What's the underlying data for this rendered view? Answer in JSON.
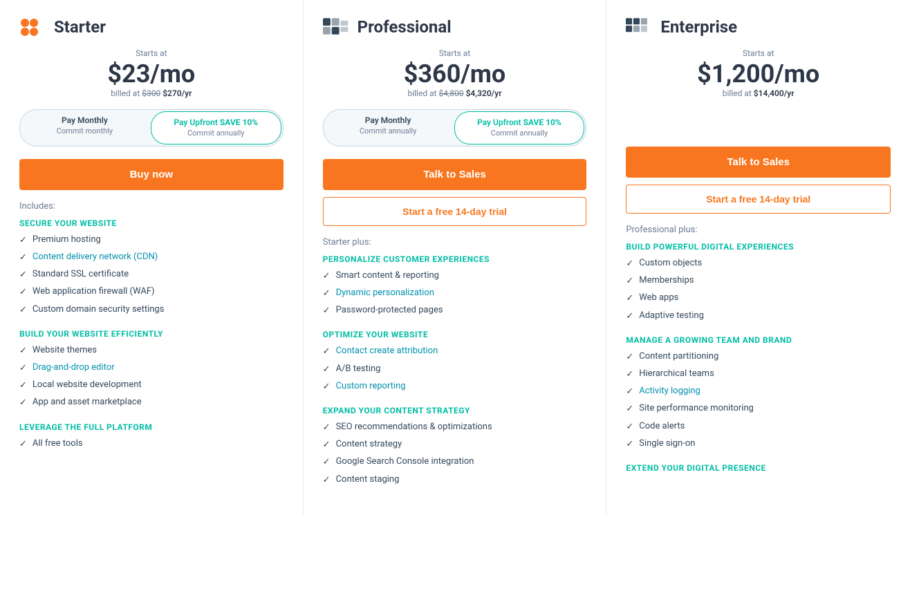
{
  "plans": [
    {
      "id": "starter",
      "title": "Starter",
      "icon_type": "starter",
      "starts_at": "Starts at",
      "price": "$23/mo",
      "billed_label": "billed at",
      "billed_original": "$300",
      "billed_discounted": "$270/yr",
      "toggle": {
        "option1": {
          "top": "Pay Monthly",
          "bottom": "Commit monthly",
          "active": false
        },
        "option2": {
          "top": "Pay Upfront",
          "save": "SAVE 10%",
          "bottom": "Commit annually",
          "active": true
        }
      },
      "cta_primary": "Buy now",
      "cta_secondary": null,
      "includes_label": "Includes:",
      "feature_groups": [
        {
          "title": "SECURE YOUR WEBSITE",
          "items": [
            {
              "text": "Premium hosting",
              "link": false
            },
            {
              "text": "Content delivery network (CDN)",
              "link": true
            },
            {
              "text": "Standard SSL certificate",
              "link": false
            },
            {
              "text": "Web application firewall (WAF)",
              "link": false
            },
            {
              "text": "Custom domain security settings",
              "link": false
            }
          ]
        },
        {
          "title": "BUILD YOUR WEBSITE EFFICIENTLY",
          "items": [
            {
              "text": "Website themes",
              "link": false
            },
            {
              "text": "Drag-and-drop editor",
              "link": true
            },
            {
              "text": "Local website development",
              "link": false
            },
            {
              "text": "App and asset marketplace",
              "link": false
            }
          ]
        },
        {
          "title": "LEVERAGE THE FULL PLATFORM",
          "items": [
            {
              "text": "All free tools",
              "link": false
            }
          ]
        }
      ]
    },
    {
      "id": "professional",
      "title": "Professional",
      "icon_type": "professional",
      "starts_at": "Starts at",
      "price": "$360/mo",
      "billed_label": "billed at",
      "billed_original": "$4,800",
      "billed_discounted": "$4,320/yr",
      "toggle": {
        "option1": {
          "top": "Pay Monthly",
          "bottom": "Commit annually",
          "active": false
        },
        "option2": {
          "top": "Pay Upfront",
          "save": "SAVE 10%",
          "bottom": "Commit annually",
          "active": true
        }
      },
      "cta_primary": "Talk to Sales",
      "cta_secondary": "Start a free 14-day trial",
      "includes_label": "Starter plus:",
      "feature_groups": [
        {
          "title": "PERSONALIZE CUSTOMER EXPERIENCES",
          "items": [
            {
              "text": "Smart content & reporting",
              "link": false
            },
            {
              "text": "Dynamic personalization",
              "link": true
            },
            {
              "text": "Password-protected pages",
              "link": false
            }
          ]
        },
        {
          "title": "OPTIMIZE YOUR WEBSITE",
          "items": [
            {
              "text": "Contact create attribution",
              "link": true
            },
            {
              "text": "A/B testing",
              "link": false
            },
            {
              "text": "Custom reporting",
              "link": true
            }
          ]
        },
        {
          "title": "EXPAND YOUR CONTENT STRATEGY",
          "items": [
            {
              "text": "SEO recommendations & optimizations",
              "link": false
            },
            {
              "text": "Content strategy",
              "link": false
            },
            {
              "text": "Google Search Console integration",
              "link": false
            },
            {
              "text": "Content staging",
              "link": false
            }
          ]
        }
      ]
    },
    {
      "id": "enterprise",
      "title": "Enterprise",
      "icon_type": "enterprise",
      "starts_at": "Starts at",
      "price": "$1,200/mo",
      "billed_label": "billed at",
      "billed_original": null,
      "billed_discounted": "$14,400/yr",
      "toggle": null,
      "cta_primary": "Talk to Sales",
      "cta_secondary": "Start a free 14-day trial",
      "includes_label": "Professional plus:",
      "feature_groups": [
        {
          "title": "BUILD POWERFUL DIGITAL EXPERIENCES",
          "items": [
            {
              "text": "Custom objects",
              "link": false
            },
            {
              "text": "Memberships",
              "link": false
            },
            {
              "text": "Web apps",
              "link": false
            },
            {
              "text": "Adaptive testing",
              "link": false
            }
          ]
        },
        {
          "title": "MANAGE A GROWING TEAM AND BRAND",
          "items": [
            {
              "text": "Content partitioning",
              "link": false
            },
            {
              "text": "Hierarchical teams",
              "link": false
            },
            {
              "text": "Activity logging",
              "link": true
            },
            {
              "text": "Site performance monitoring",
              "link": false
            },
            {
              "text": "Code alerts",
              "link": false
            },
            {
              "text": "Single sign-on",
              "link": false
            }
          ]
        },
        {
          "title": "EXTEND YOUR DIGITAL PRESENCE",
          "items": []
        }
      ]
    }
  ],
  "colors": {
    "orange": "#f8761f",
    "teal": "#00bda5",
    "dark_blue": "#2d3748",
    "mid_blue": "#33475b",
    "link_blue": "#0091ae",
    "gray": "#6b7c93"
  }
}
